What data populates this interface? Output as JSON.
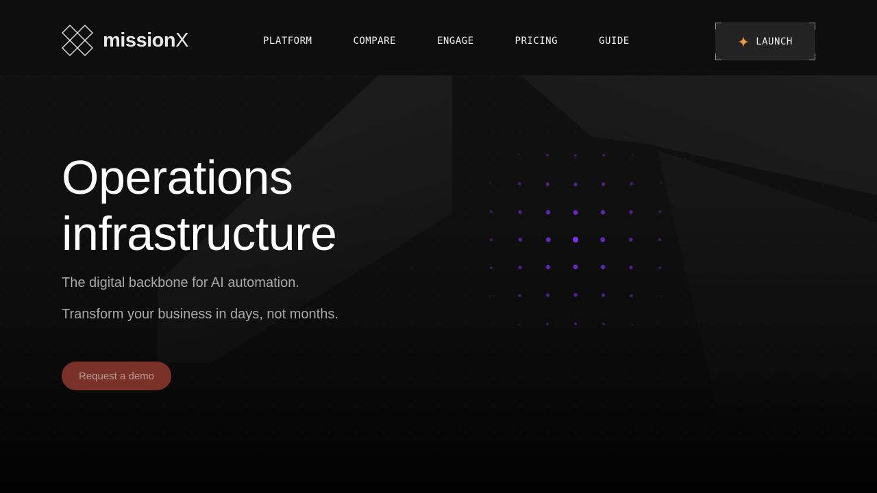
{
  "brand": {
    "name": "mission",
    "name_suffix": "X",
    "accent_color": "#7c2ee6",
    "cta_color": "#7a3128"
  },
  "nav": {
    "links": [
      "PLATFORM",
      "COMPARE",
      "ENGAGE",
      "PRICING",
      "GUIDE"
    ],
    "launch_label": "LAUNCH",
    "launch_icon": "sparkle-icon"
  },
  "hero": {
    "title_line1": "Operations",
    "title_line2": "infrastructure",
    "subtitle1": "The digital backbone for AI automation.",
    "subtitle2": "Transform your business in days, not months.",
    "cta_label": "Request a demo"
  }
}
